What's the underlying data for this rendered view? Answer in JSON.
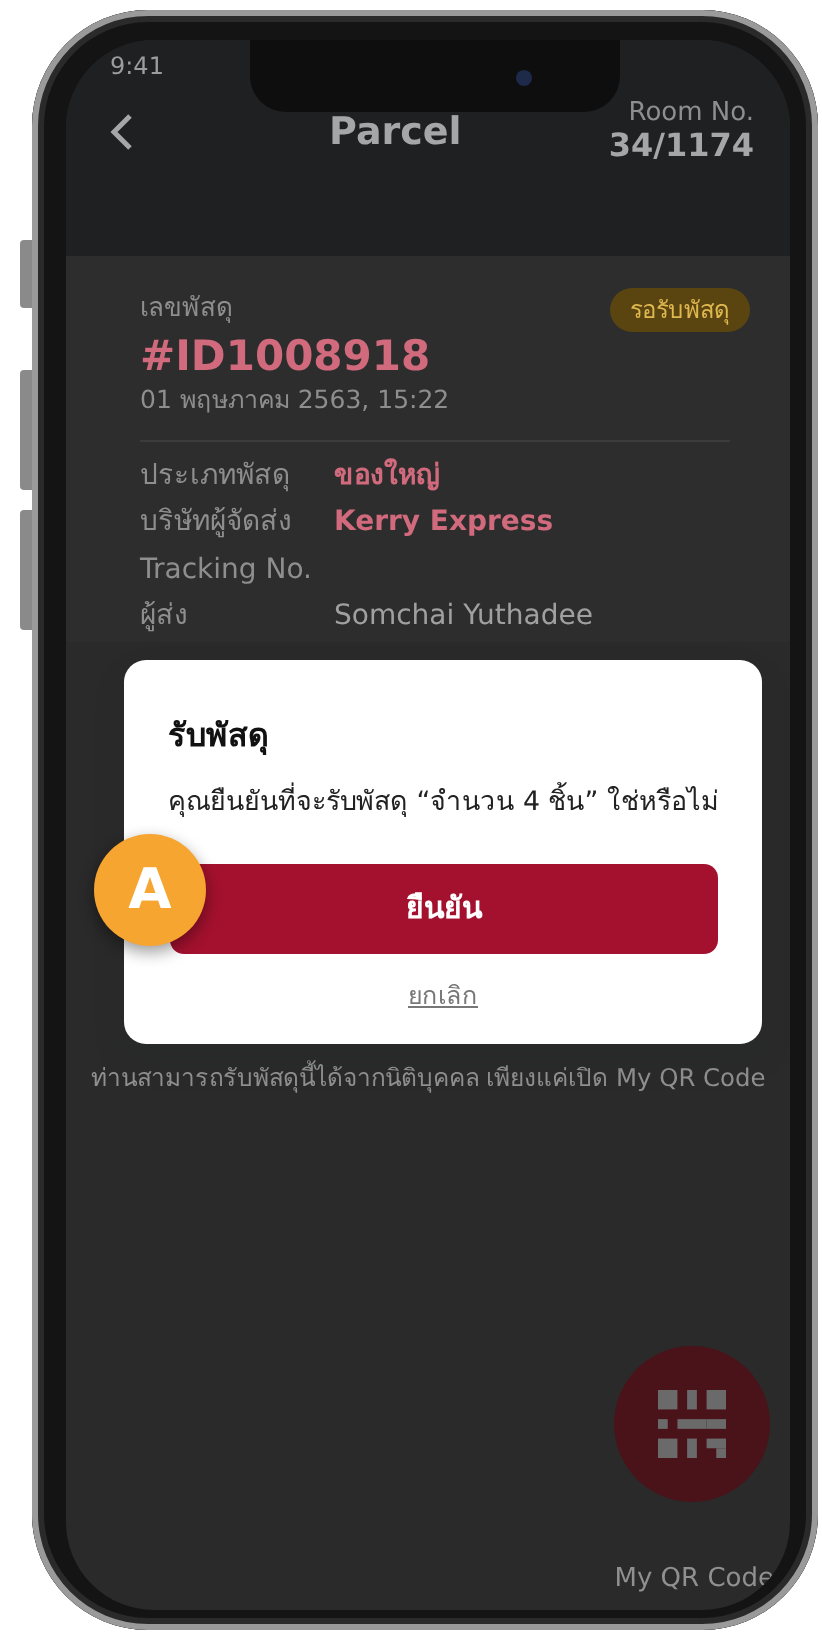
{
  "status_bar": {
    "time": "9:41"
  },
  "header": {
    "title": "Parcel",
    "room_label": "Room No.",
    "room_number": "34/1174"
  },
  "parcel": {
    "number_label": "เลขพัสดุ",
    "status": "รอรับพัสดุ",
    "id": "#ID1008918",
    "date": "01 พฤษภาคม 2563, 15:22",
    "details": [
      {
        "label": "ประเภทพัสดุ",
        "value": "ของใหญ่",
        "highlight": true
      },
      {
        "label": "บริษัทผู้จัดส่ง",
        "value": "Kerry Express",
        "highlight": true
      },
      {
        "label": "Tracking No."
      },
      {
        "label": "ผู้ส่ง",
        "value": "Somchai Yuthadee",
        "highlight": false
      }
    ],
    "note": "ท่านสามารถรับพัสดุนี้ได้จากนิติบุคคล เพียงแค่เปิด My QR Code"
  },
  "qr_button": {
    "label": "My QR Code"
  },
  "dialog": {
    "title": "รับพัสดุ",
    "message": "คุณยืนยันที่จะรับพัสดุ “จำนวน 4 ชิ้น” ใช่หรือไม่",
    "confirm": "ยืนยัน",
    "cancel": "ยกเลิก"
  },
  "marker": "A"
}
